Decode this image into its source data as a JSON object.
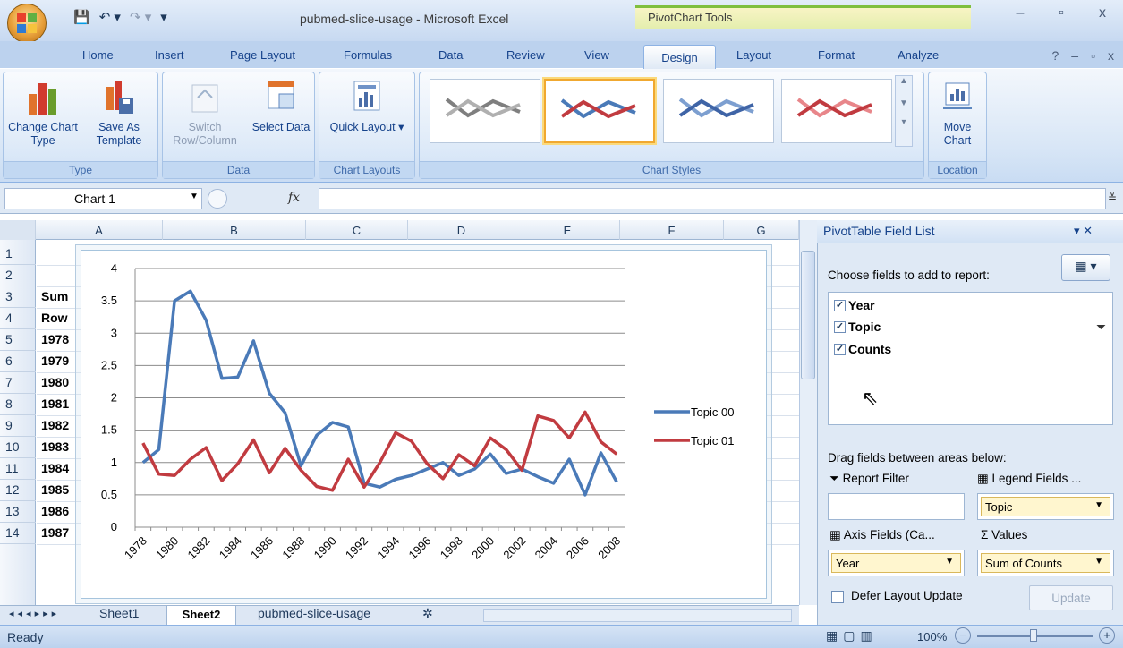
{
  "window": {
    "title": "pubmed-slice-usage - Microsoft Excel",
    "context_title": "PivotChart Tools",
    "controls": [
      "–",
      "▫",
      "x"
    ]
  },
  "tabs": [
    "Home",
    "Insert",
    "Page Layout",
    "Formulas",
    "Data",
    "Review",
    "View",
    "Design",
    "Layout",
    "Format",
    "Analyze"
  ],
  "active_tab": "Design",
  "ribbon": {
    "type_group": {
      "label": "Type",
      "change_chart_type": "Change Chart Type",
      "save_as_template": "Save As Template"
    },
    "data_group": {
      "label": "Data",
      "switch_row_column": "Switch Row/Column",
      "select_data": "Select Data"
    },
    "chart_layouts_group": {
      "label": "Chart Layouts",
      "quick_layout": "Quick Layout ▾"
    },
    "chart_styles_group": {
      "label": "Chart Styles"
    },
    "location_group": {
      "label": "Location",
      "move_chart": "Move Chart"
    }
  },
  "formula_bar": {
    "name_box": "Chart 1",
    "fx": "fx",
    "formula": ""
  },
  "columns": [
    "A",
    "B",
    "C",
    "D",
    "E",
    "F",
    "G"
  ],
  "rows": [
    "1",
    "2",
    "3",
    "4",
    "5",
    "6",
    "7",
    "8",
    "9",
    "10",
    "11",
    "12",
    "13",
    "14"
  ],
  "column_a_cells": [
    "",
    "",
    "Sum",
    "Row",
    "1978",
    "1979",
    "1980",
    "1981",
    "1982",
    "1983",
    "1984",
    "1985",
    "1986",
    "1987"
  ],
  "chart_data": {
    "type": "line",
    "categories": [
      "1978",
      "1979",
      "1980",
      "1981",
      "1982",
      "1983",
      "1984",
      "1985",
      "1986",
      "1987",
      "1988",
      "1989",
      "1990",
      "1991",
      "1992",
      "1993",
      "1994",
      "1995",
      "1996",
      "1997",
      "1998",
      "1999",
      "2000",
      "2001",
      "2002",
      "2003",
      "2004",
      "2005",
      "2006",
      "2007",
      "2008"
    ],
    "x_tick_labels": [
      "1978",
      "1980",
      "1982",
      "1984",
      "1986",
      "1988",
      "1990",
      "1992",
      "1994",
      "1996",
      "1998",
      "2000",
      "2002",
      "2004",
      "2006",
      "2008"
    ],
    "series": [
      {
        "name": "Topic 00",
        "color": "#4a7ab8",
        "values": [
          1.0,
          1.2,
          3.5,
          3.65,
          3.2,
          2.3,
          2.32,
          2.88,
          2.07,
          1.77,
          0.95,
          1.42,
          1.62,
          1.55,
          0.68,
          0.62,
          0.74,
          0.8,
          0.9,
          1.0,
          0.8,
          0.9,
          1.13,
          0.83,
          0.9,
          0.78,
          0.68,
          1.05,
          0.5,
          1.15,
          0.7
        ]
      },
      {
        "name": "Topic 01",
        "color": "#c13b40",
        "values": [
          1.3,
          0.82,
          0.8,
          1.05,
          1.23,
          0.72,
          0.98,
          1.35,
          0.84,
          1.22,
          0.88,
          0.63,
          0.57,
          1.05,
          0.62,
          1.0,
          1.46,
          1.33,
          0.98,
          0.75,
          1.12,
          0.95,
          1.38,
          1.2,
          0.88,
          1.72,
          1.65,
          1.38,
          1.78,
          1.32,
          1.13
        ]
      }
    ],
    "y_ticks": [
      "0",
      "0.5",
      "1",
      "1.5",
      "2",
      "2.5",
      "3",
      "3.5",
      "4"
    ],
    "ylim": [
      0,
      4
    ],
    "grid": true,
    "legend_position": "right"
  },
  "sheet_tabs": [
    "Sheet1",
    "Sheet2",
    "pubmed-slice-usage"
  ],
  "active_sheet": "Sheet2",
  "pivot": {
    "title": "PivotTable Field List",
    "choose_label": "Choose fields to add to report:",
    "fields": [
      "Year",
      "Topic",
      "Counts"
    ],
    "drag_label": "Drag fields between areas below:",
    "report_filter": "Report Filter",
    "legend_fields": "Legend Fields ...",
    "axis_fields": "Axis Fields (Ca...",
    "values_label": "Values",
    "legend_value": "Topic",
    "axis_value": "Year",
    "values_value": "Sum of Counts",
    "defer_label": "Defer Layout Update",
    "update_label": "Update"
  },
  "status": {
    "text": "Ready",
    "zoom": "100%"
  }
}
